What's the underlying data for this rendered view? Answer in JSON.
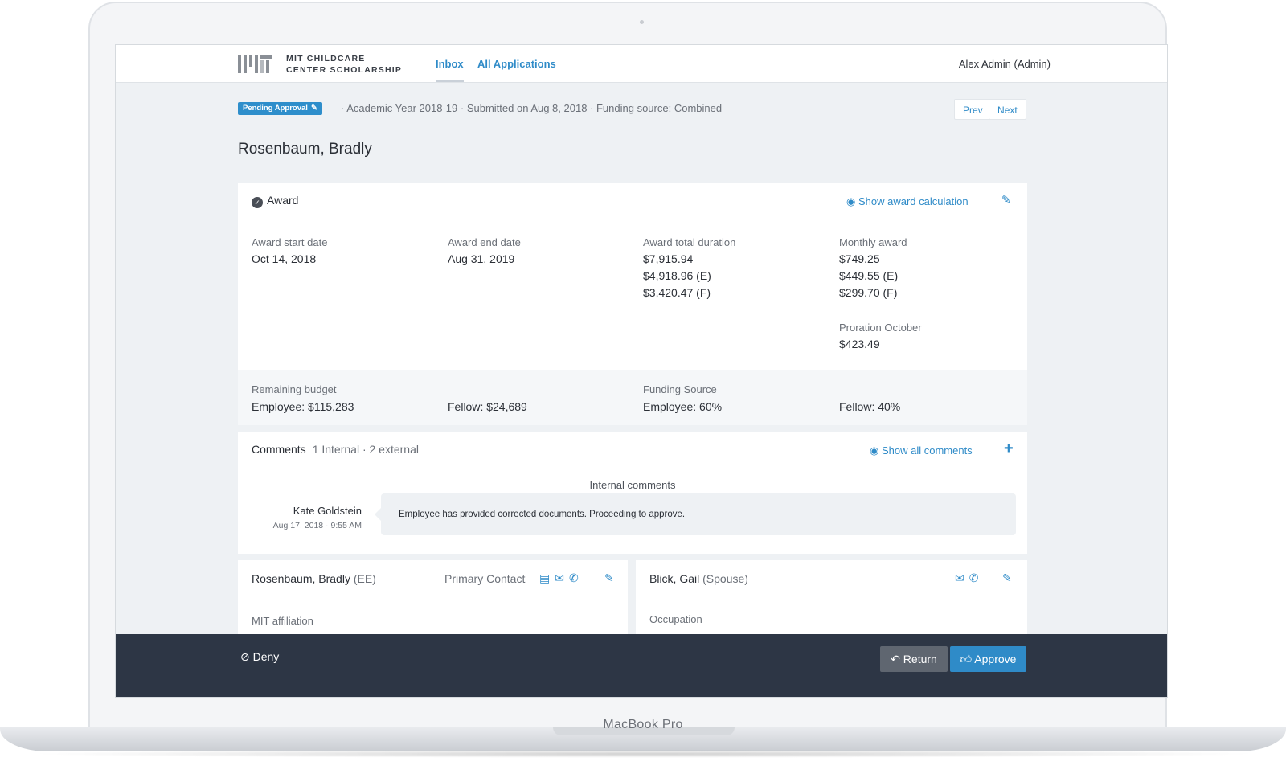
{
  "device": {
    "label": "MacBook Pro"
  },
  "nav": {
    "org_line1": "MIT CHILDCARE",
    "org_line2": "CENTER SCHOLARSHIP",
    "tabs": [
      {
        "label": "Inbox",
        "active": true
      },
      {
        "label": "All Applications",
        "active": false
      }
    ],
    "user": "Alex Admin (Admin)"
  },
  "status": {
    "badge": "Pending Approval",
    "meta": "· Academic Year 2018-19 · Submitted on Aug 8, 2018 · Funding source: Combined",
    "prev": "Prev",
    "next": "Next"
  },
  "applicant": {
    "name": "Rosenbaum, Bradly"
  },
  "award": {
    "title": "Award",
    "calc_link": "Show award calculation",
    "start_label": "Award start date",
    "start_value": "Oct 14, 2018",
    "end_label": "Award end date",
    "end_value": "Aug 31, 2019",
    "total_label": "Award total duration",
    "total_values": [
      "$7,915.94",
      "$4,918.96 (E)",
      "$3,420.47 (F)"
    ],
    "monthly_label": "Monthly award",
    "monthly_values": [
      "$749.25",
      "$449.55 (E)",
      "$299.70 (F)"
    ],
    "proration_label": "Proration October",
    "proration_value": "$423.49",
    "budget_label": "Remaining budget",
    "budget_employee": "Employee: $115,283",
    "budget_fellow": "Fellow: $24,689",
    "funding_label": "Funding Source",
    "funding_employee": "Employee: 60%",
    "funding_fellow": "Fellow: 40%"
  },
  "comments": {
    "title": "Comments",
    "count": "1 Internal · 2 external",
    "show_all": "Show all comments",
    "section": "Internal comments",
    "author": "Kate Goldstein",
    "time": "Aug 17, 2018 · 9:55 AM",
    "text": "Employee has provided corrected documents. Proceeding to approve."
  },
  "contacts": {
    "left_name": "Rosenbaum, Bradly",
    "left_role": "(EE)",
    "left_tag": "Primary Contact",
    "left_field": "MIT affiliation",
    "right_name": "Blick, Gail",
    "right_role": "(Spouse)",
    "right_field": "Occupation"
  },
  "actions": {
    "deny": "Deny",
    "return": "Return",
    "approve": "Approve"
  },
  "colors": {
    "accent": "#2f8bc8",
    "action_bar": "#2d3645",
    "background": "#eef1f4"
  }
}
